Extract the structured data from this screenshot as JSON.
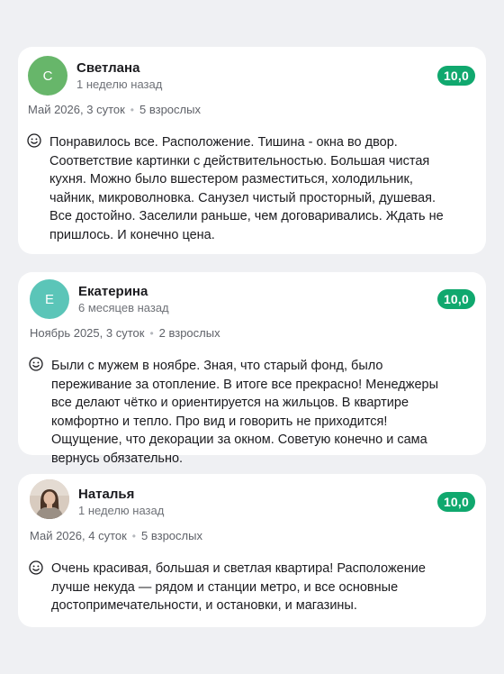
{
  "reviews": [
    {
      "avatar_letter": "С",
      "name": "Светлана",
      "when": "1 неделю назад",
      "score": "10,0",
      "stay_dates": "Май 2026, 3 суток",
      "stay_guests": "5 взрослых",
      "text": "Понравилось все. Расположение. Тишина - окна во двор. Соответствие картинки с действительностью. Большая чистая кухня. Можно было вшестером разместиться, холодильник, чайник, микроволновка. Санузел чистый просторный, душевая. Все достойно. Заселили раньше, чем договаривались. Ждать не пришлось. И конечно цена."
    },
    {
      "avatar_letter": "Е",
      "name": "Екатерина",
      "when": "6 месяцев назад",
      "score": "10,0",
      "stay_dates": "Ноябрь 2025, 3 суток",
      "stay_guests": "2 взрослых",
      "text": "Были с мужем в ноябре. Зная, что старый фонд, было переживание за отопление. В итоге все прекрасно! Менеджеры все делают чётко и ориентируется на жильцов. В квартире комфортно и тепло. Про вид и говорить не приходится! Ощущение, что декорации за окном. Советую конечно и сама вернусь обязательно."
    },
    {
      "name": "Наталья",
      "when": "1 неделю назад",
      "score": "10,0",
      "stay_dates": "Май 2026, 4 суток",
      "stay_guests": "5 взрослых",
      "text": "Очень красивая, большая и светлая квартира! Расположение лучше некуда — рядом и станции метро, и все основные достопримечательности, и остановки, и магазины."
    }
  ],
  "icons": {
    "review_icon": "smile-icon",
    "photo": "user-photo"
  },
  "colors": {
    "score_badge": "#10a86e",
    "avatar_svetlana": "#67b66a",
    "avatar_ekaterina": "#5bc5b8",
    "background": "#eff0f3"
  }
}
